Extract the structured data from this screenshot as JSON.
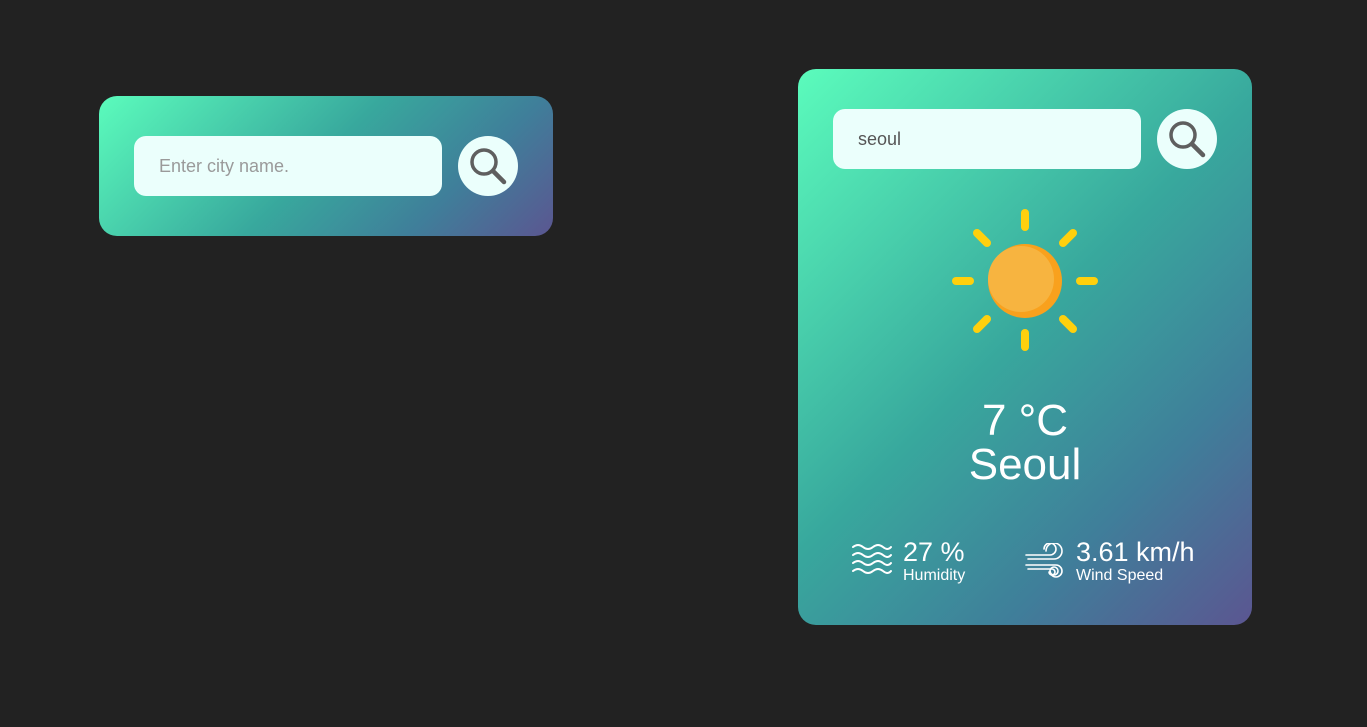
{
  "search_panel": {
    "input_value": "",
    "input_placeholder": "Enter city name.",
    "search_icon": "search-icon"
  },
  "weather_panel": {
    "input_value": "seoul",
    "input_placeholder": "Enter city name.",
    "search_icon": "search-icon",
    "condition_icon": "sun-icon",
    "temperature": "7 °C",
    "city": "Seoul",
    "humidity": {
      "icon": "humidity-waves-icon",
      "value": "27 %",
      "label": "Humidity"
    },
    "wind": {
      "icon": "wind-icon",
      "value": "3.61 km/h",
      "label": "Wind Speed"
    }
  },
  "colors": {
    "page_background": "#222222",
    "card_gradient_start": "#5bfcbc",
    "card_gradient_end": "#5b5691",
    "input_background": "#ebfffc",
    "sun_core": "#f7b13f",
    "sun_rays": "#ffd00d"
  }
}
